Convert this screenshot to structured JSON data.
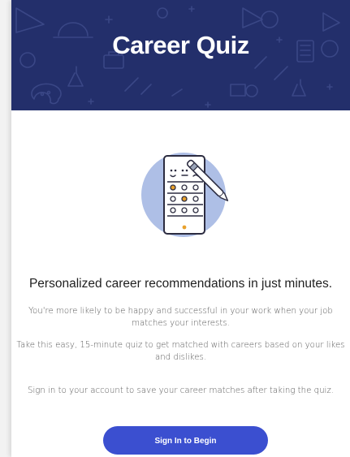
{
  "banner": {
    "title": "Career Quiz",
    "background_color": "#232f6b"
  },
  "illustration": {
    "icon": "quiz-tablet-icon",
    "faces": [
      "happy",
      "neutral",
      "sad"
    ]
  },
  "content": {
    "headline": "Personalized career recommendations in just minutes.",
    "paragraph_1": "You're more likely to be happy and successful in your work when your job matches your interests.",
    "paragraph_2": "Take this easy, 15-minute quiz to get matched with careers based on your likes and dislikes.",
    "paragraph_3": "Sign in to your account to save your career matches after taking the quiz."
  },
  "actions": {
    "sign_in_label": "Sign In to Begin",
    "button_color": "#3b4fd0"
  }
}
